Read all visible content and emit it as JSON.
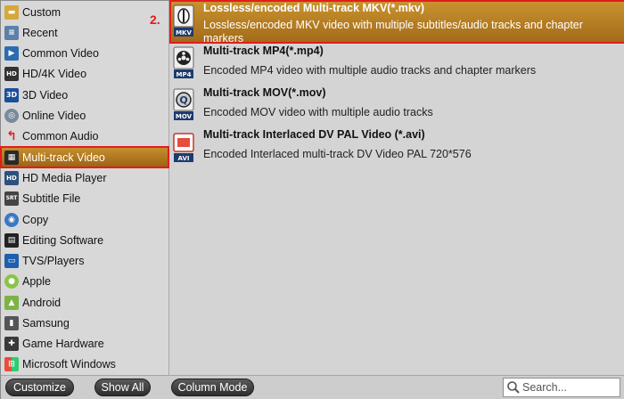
{
  "sidebar": {
    "items": [
      {
        "label": "Custom",
        "icon": "custom-folder-icon"
      },
      {
        "label": "Recent",
        "icon": "recent-list-icon"
      },
      {
        "label": "Common Video",
        "icon": "film-icon"
      },
      {
        "label": "HD/4K Video",
        "icon": "hd-icon"
      },
      {
        "label": "3D Video",
        "icon": "3d-icon"
      },
      {
        "label": "Online Video",
        "icon": "globe-icon"
      },
      {
        "label": "Common Audio",
        "icon": "audio-arrow-icon"
      },
      {
        "label": "Multi-track Video",
        "icon": "filmstrip-icon",
        "selected": true
      },
      {
        "label": "HD Media Player",
        "icon": "hd-player-icon"
      },
      {
        "label": "Subtitle File",
        "icon": "subtitle-icon"
      },
      {
        "label": "Copy",
        "icon": "copy-icon"
      },
      {
        "label": "Editing Software",
        "icon": "clapboard-icon"
      },
      {
        "label": "TVS/Players",
        "icon": "tv-icon"
      },
      {
        "label": "Apple",
        "icon": "apple-icon"
      },
      {
        "label": "Android",
        "icon": "android-icon"
      },
      {
        "label": "Samsung",
        "icon": "samsung-phone-icon"
      },
      {
        "label": "Game Hardware",
        "icon": "gamepad-icon"
      },
      {
        "label": "Microsoft Windows",
        "icon": "windows-icon"
      }
    ]
  },
  "formats": [
    {
      "title": "Lossless/encoded Multi-track MKV(*.mkv)",
      "desc": "Lossless/encoded MKV video with multiple subtitles/audio tracks and chapter markers",
      "icon": "mkv-icon",
      "icon_text": "MKV",
      "selected": true
    },
    {
      "title": "Multi-track MP4(*.mp4)",
      "desc": "Encoded MP4 video with multiple audio tracks and chapter markers",
      "icon": "mp4-icon",
      "icon_text": "MP4"
    },
    {
      "title": "Multi-track MOV(*.mov)",
      "desc": "Encoded MOV video with multiple audio tracks",
      "icon": "mov-icon",
      "icon_text": "MOV"
    },
    {
      "title": "Multi-track Interlaced DV PAL Video (*.avi)",
      "desc": "Encoded Interlaced multi-track DV Video PAL 720*576",
      "icon": "avi-icon",
      "icon_text": "AVI"
    }
  ],
  "annotation": {
    "step_label": "2."
  },
  "bottombar": {
    "customize_label": "Customize",
    "show_all_label": "Show All",
    "column_mode_label": "Column Mode",
    "search_placeholder": "Search..."
  },
  "colors": {
    "selection": "#b07a22",
    "highlight_border": "#e21d1d"
  }
}
